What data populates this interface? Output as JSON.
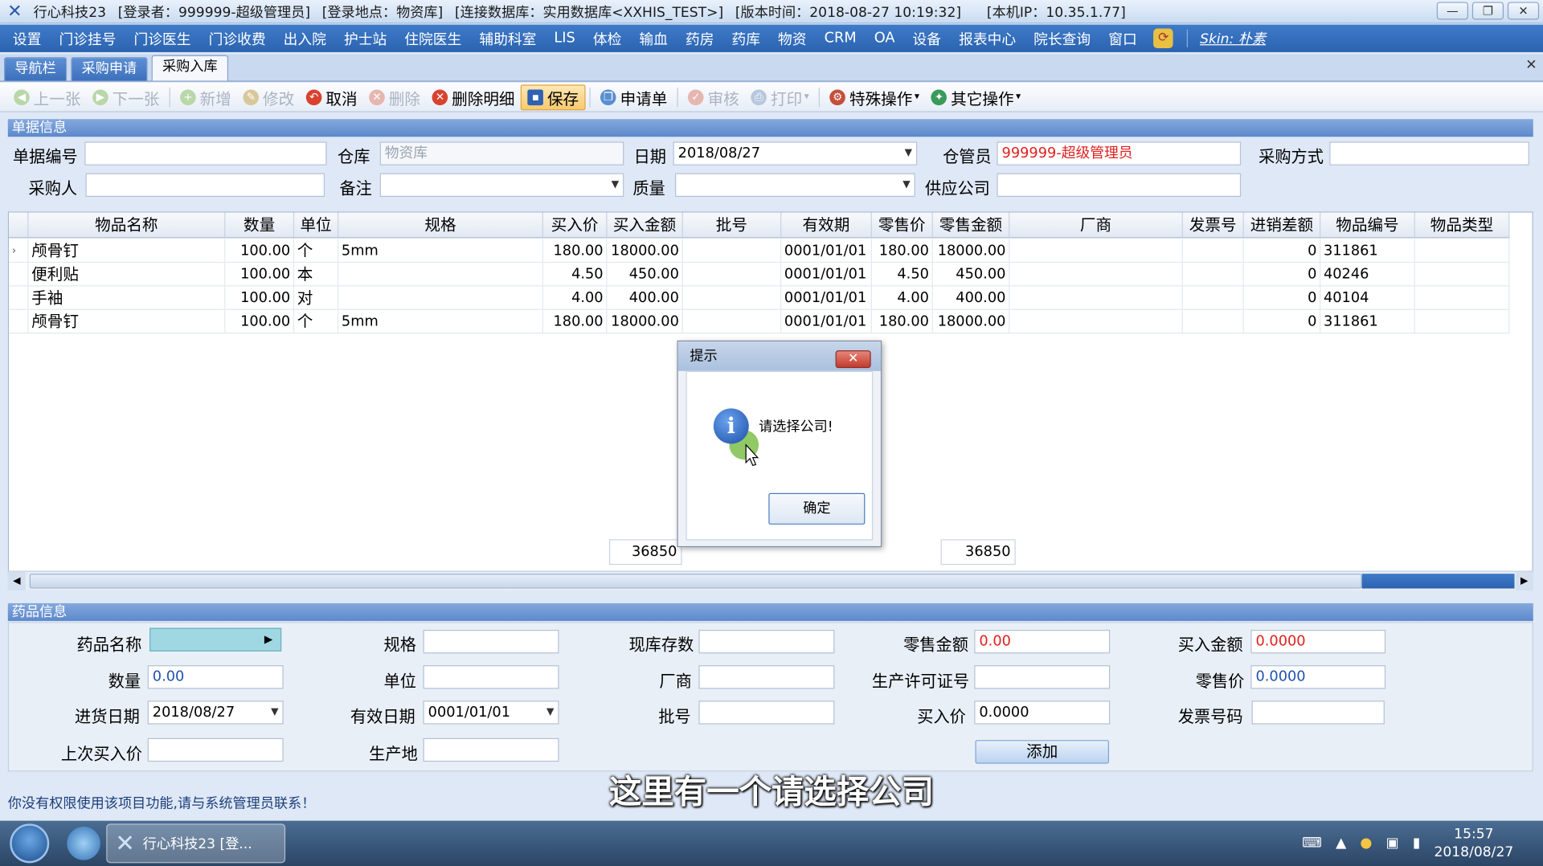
{
  "window": {
    "app_name": "行心科技23",
    "login_user": "[登录者：999999-超级管理员]",
    "login_place": "[登录地点：物资库]",
    "database": "[连接数据库：实用数据库<XXHIS_TEST>]",
    "version": "[版本时间：2018-08-27 10:19:32]",
    "ip": "[本机IP：10.35.1.77]"
  },
  "menu": [
    "设置",
    "门诊挂号",
    "门诊医生",
    "门诊收费",
    "出入院",
    "护士站",
    "住院医生",
    "辅助科室",
    "LIS",
    "体检",
    "输血",
    "药房",
    "药库",
    "物资",
    "CRM",
    "OA",
    "设备",
    "报表中心",
    "院长查询",
    "窗口"
  ],
  "skin": "Skin: 朴素",
  "tabs": [
    "导航栏",
    "采购申请",
    "采购入库"
  ],
  "toolbar": {
    "prev": "上一张",
    "next": "下一张",
    "add": "新增",
    "edit": "修改",
    "cancel": "取消",
    "delete": "删除",
    "delete_detail": "删除明细",
    "save": "保存",
    "request": "申请单",
    "audit": "审核",
    "print": "打印",
    "special": "特殊操作",
    "other": "其它操作"
  },
  "doc_section": "单据信息",
  "doc": {
    "bill_no_label": "单据编号",
    "bill_no": "",
    "warehouse_label": "仓库",
    "warehouse": "物资库",
    "date_label": "日期",
    "date": "2018/08/27",
    "keeper_label": "仓管员",
    "keeper": "999999-超级管理员",
    "purchase_mode_label": "采购方式",
    "purchase_mode": "",
    "buyer_label": "采购人",
    "buyer": "",
    "remark_label": "备注",
    "remark": "",
    "quality_label": "质量",
    "quality": "",
    "supplier_label": "供应公司",
    "supplier": ""
  },
  "grid": {
    "headers": [
      "物品名称",
      "数量",
      "单位",
      "规格",
      "买入价",
      "买入金额",
      "批号",
      "有效期",
      "零售价",
      "零售金额",
      "厂商",
      "发票号",
      "进销差额",
      "物品编号",
      "物品类型"
    ],
    "rows": [
      [
        "颅骨钉",
        "100.00",
        "个",
        "5mm",
        "180.00",
        "18000.00",
        "",
        "0001/01/01",
        "180.00",
        "18000.00",
        "",
        "",
        "0",
        "311861",
        ""
      ],
      [
        "便利贴",
        "100.00",
        "本",
        "",
        "4.50",
        "450.00",
        "",
        "0001/01/01",
        "4.50",
        "450.00",
        "",
        "",
        "0",
        "40246",
        ""
      ],
      [
        "手袖",
        "100.00",
        "对",
        "",
        "4.00",
        "400.00",
        "",
        "0001/01/01",
        "4.00",
        "400.00",
        "",
        "",
        "0",
        "40104",
        ""
      ],
      [
        "颅骨钉",
        "100.00",
        "个",
        "5mm",
        "180.00",
        "18000.00",
        "",
        "0001/01/01",
        "180.00",
        "18000.00",
        "",
        "",
        "0",
        "311861",
        ""
      ]
    ],
    "total_buy": "36850",
    "total_retail": "36850"
  },
  "dialog": {
    "title": "提示",
    "message": "请选择公司!",
    "ok": "确定"
  },
  "drug_section": "药品信息",
  "drug": {
    "name_label": "药品名称",
    "name": "",
    "spec_label": "规格",
    "spec": "",
    "stock_label": "现库存数",
    "stock": "",
    "retail_amount_label": "零售金额",
    "retail_amount": "0.00",
    "buy_amount_label": "买入金额",
    "buy_amount": "0.0000",
    "qty_label": "数量",
    "qty": "0.00",
    "unit_label": "单位",
    "unit": "",
    "maker_label": "厂商",
    "maker": "",
    "license_label": "生产许可证号",
    "license": "",
    "retail_price_label": "零售价",
    "retail_price": "0.0000",
    "in_date_label": "进货日期",
    "in_date": "2018/08/27",
    "expiry_label": "有效日期",
    "expiry": "0001/01/01",
    "batch_label": "批号",
    "batch": "",
    "buy_price_label": "买入价",
    "buy_price": "0.0000",
    "invoice_label": "发票号码",
    "invoice": "",
    "last_price_label": "上次买入价",
    "last_price": "",
    "origin_label": "生产地",
    "origin": "",
    "add_button": "添加"
  },
  "status": "你没有权限使用该项目功能,请与系统管理员联系！",
  "subtitle": "这里有一个请选择公司",
  "taskbar": {
    "app": "行心科技23 [登...",
    "time": "15:57",
    "date": "2018/08/27"
  },
  "colors": {
    "menu_bg": "#2b63b0",
    "accent_red": "#e02020",
    "section": "#5d89cb"
  }
}
